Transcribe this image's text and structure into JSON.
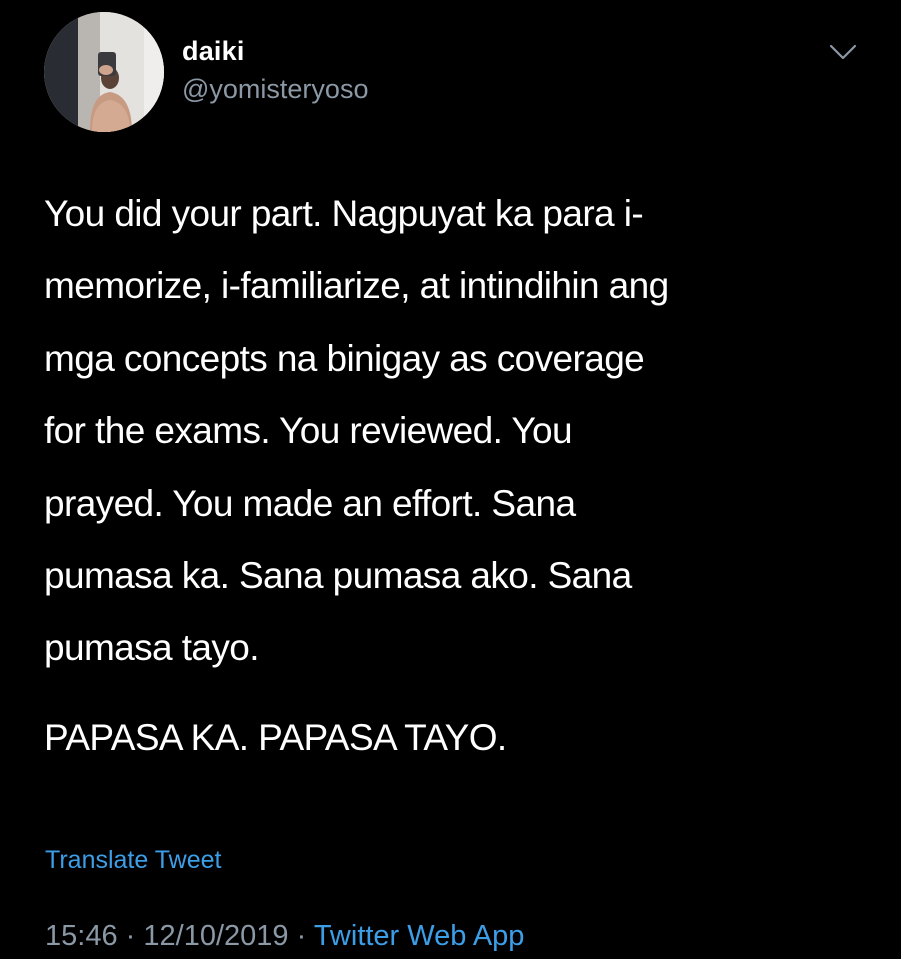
{
  "user": {
    "display_name": "daiki",
    "handle": "@yomisteryoso",
    "avatar_icon": "profile-photo"
  },
  "menu": {
    "icon": "chevron-down-icon"
  },
  "tweet": {
    "lines": [
      "You did your part. Nagpuyat ka para i-",
      "memorize, i-familiarize, at intindihin ang",
      "mga concepts na binigay as coverage",
      "for the exams. You reviewed. You",
      "prayed. You made an effort. Sana",
      "pumasa ka. Sana pumasa ako. Sana",
      "pumasa tayo."
    ],
    "closing": "PAPASA KA. PAPASA TAYO."
  },
  "translate_label": "Translate Tweet",
  "meta": {
    "time": "15:46",
    "separator": "·",
    "date": "12/10/2019",
    "app": "Twitter Web App"
  },
  "colors": {
    "background": "#000000",
    "text": "#ffffff",
    "secondary": "#8b98a5",
    "link": "#3d9ee8"
  }
}
